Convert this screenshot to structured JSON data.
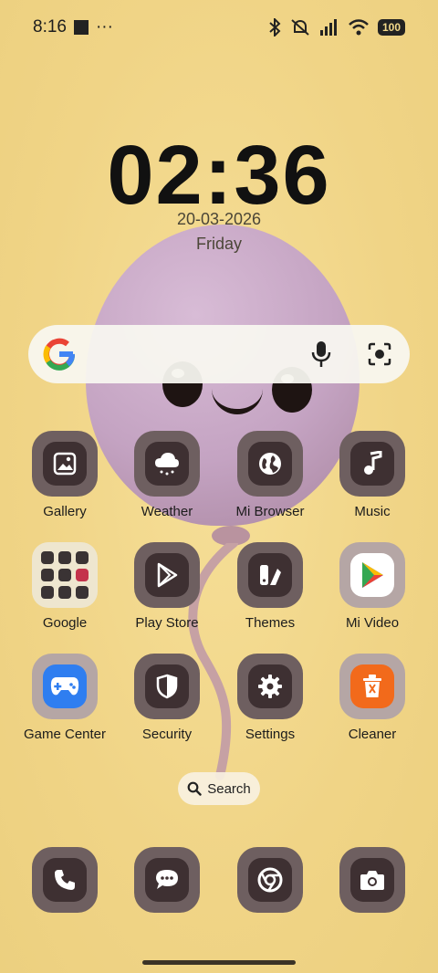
{
  "status_bar": {
    "time": "8:16",
    "more": "···",
    "battery": "100",
    "icons": [
      "bluetooth-icon",
      "silent-icon",
      "signal-icon",
      "wifi-icon",
      "battery-icon"
    ]
  },
  "clock": {
    "time": "02:36",
    "date": "20-03-2026",
    "day": "Friday"
  },
  "search_bar": {
    "logo": "G",
    "icons": [
      "mic-icon",
      "lens-icon"
    ]
  },
  "apps": {
    "row1": [
      {
        "label": "Gallery"
      },
      {
        "label": "Weather"
      },
      {
        "label": "Mi Browser"
      },
      {
        "label": "Music"
      }
    ],
    "row2": [
      {
        "label": "Google"
      },
      {
        "label": "Play Store"
      },
      {
        "label": "Themes"
      },
      {
        "label": "Mi Video"
      }
    ],
    "row3": [
      {
        "label": "Game Center"
      },
      {
        "label": "Security"
      },
      {
        "label": "Settings"
      },
      {
        "label": "Cleaner"
      }
    ]
  },
  "app_search": {
    "label": "Search"
  },
  "dock": [
    "phone-icon",
    "messages-icon",
    "chrome-icon",
    "camera-icon"
  ],
  "colors": {
    "wallpaper": "#f2d88a",
    "icon_outer": "#6e5f60",
    "icon_inner": "#3e3032",
    "cleaner_orange": "#f26a1b",
    "game_blue": "#2f7ef0"
  }
}
